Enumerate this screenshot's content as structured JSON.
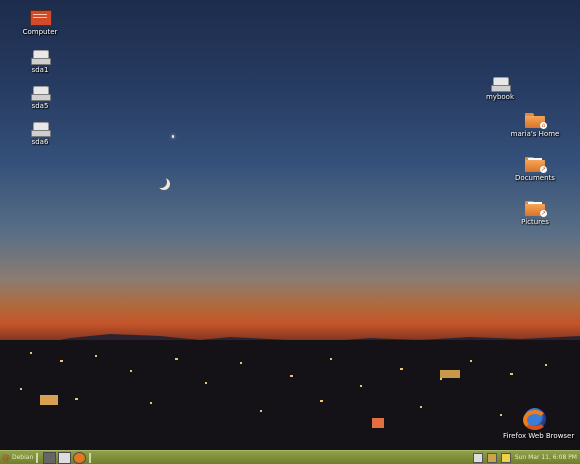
{
  "desktop": {
    "icons_left": [
      {
        "name": "computer",
        "label": "Computer"
      },
      {
        "name": "sda1",
        "label": "sda1"
      },
      {
        "name": "sda5",
        "label": "sda5"
      },
      {
        "name": "sda6",
        "label": "sda6"
      }
    ],
    "icons_right": [
      {
        "name": "mybook",
        "label": "mybook"
      },
      {
        "name": "home",
        "label": "maria's Home"
      },
      {
        "name": "documents",
        "label": "Documents"
      },
      {
        "name": "pictures",
        "label": "Pictures"
      },
      {
        "name": "firefox",
        "label": "Firefox Web Browser"
      }
    ]
  },
  "panel": {
    "menu_label": "Debian",
    "clock": "Sun Mar 11,  6:08 PM",
    "launchers": [
      "terminal-icon",
      "screensaver-icon",
      "firefox-icon"
    ],
    "tray_icons": [
      "window-list-icon",
      "lock-icon",
      "mail-icon"
    ]
  },
  "colors": {
    "panel": "#7f8f3a",
    "sky_top": "#1d2c4c",
    "horizon": "#c4542a"
  }
}
